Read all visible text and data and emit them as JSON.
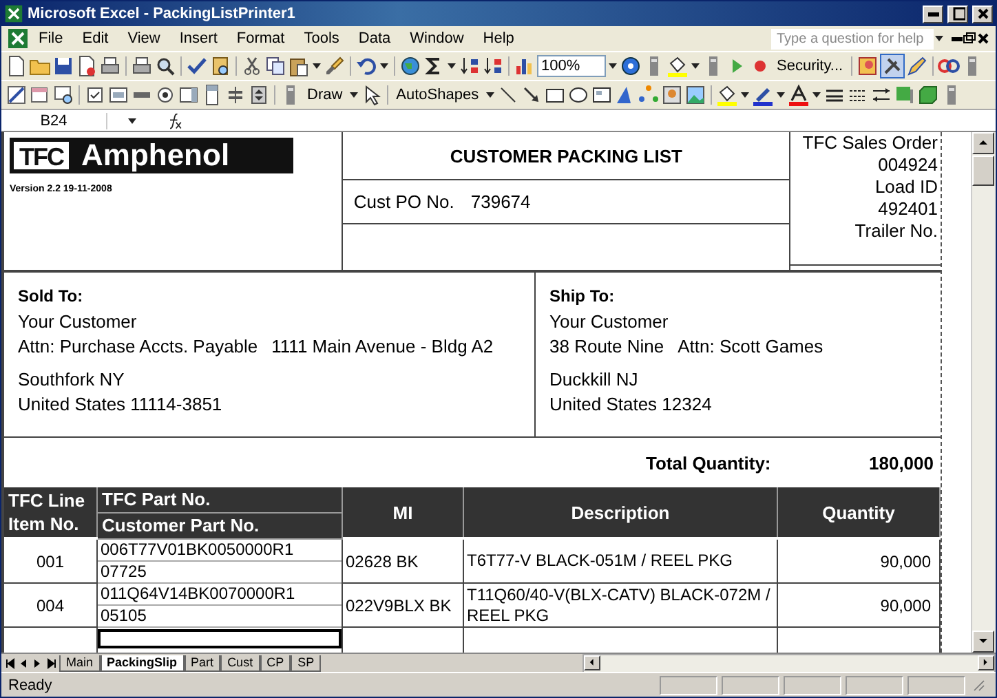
{
  "window": {
    "title": "Microsoft Excel - PackingListPrinter1"
  },
  "menu": {
    "items": [
      "File",
      "Edit",
      "View",
      "Insert",
      "Format",
      "Tools",
      "Data",
      "Window",
      "Help"
    ],
    "help_box": {
      "placeholder": "Type a question for help"
    }
  },
  "standard_toolbar": {
    "zoom": "100%",
    "security": "Security..."
  },
  "drawing_toolbar": {
    "draw": "Draw",
    "autoshapes": "AutoShapes"
  },
  "formula_bar": {
    "name_box": "B24"
  },
  "sheet": {
    "header": {
      "logo_mark": "TFC",
      "logo_text": "Amphenol",
      "version": "Version 2.2 19-11-2008",
      "title": "CUSTOMER PACKING LIST",
      "cust_po_label": "Cust PO No.",
      "cust_po": "739674",
      "sales_order_label": "TFC Sales Order",
      "sales_order": "004924",
      "load_id_label": "Load ID",
      "load_id": "492401",
      "trailer_label": "Trailer No."
    },
    "sold_to": {
      "heading": "Sold To:",
      "name": "Your Customer",
      "line_a": "Attn: Purchase Accts. Payable",
      "line_b": "1111 Main Avenue - Bldg A2",
      "city": "Southfork  NY",
      "country": "United States  11114-3851"
    },
    "ship_to": {
      "heading": "Ship To:",
      "name": "Your Customer",
      "line_a": "38 Route Nine",
      "line_b": "Attn: Scott Games",
      "city": "Duckkill  NJ",
      "country": "United States  12324"
    },
    "total": {
      "label": "Total Quantity:",
      "value": "180,000"
    },
    "table": {
      "columns": [
        "TFC Line Item No.",
        "TFC Part No.",
        "Customer Part No.",
        "MI",
        "Description",
        "Quantity"
      ],
      "rows": [
        {
          "line": "001",
          "tfc_part": "006T77V01BK0050000R1",
          "customer_part": "07725",
          "mi": "02628 BK",
          "description": "T6T77-V BLACK-051M / REEL PKG",
          "quantity": "90,000"
        },
        {
          "line": "004",
          "tfc_part": "011Q64V14BK0070000R1",
          "customer_part": "05105",
          "mi": "022V9BLX BK",
          "description": "T11Q60/40-V(BLX-CATV) BLACK-072M / REEL PKG",
          "quantity": "90,000"
        }
      ]
    }
  },
  "sheet_tabs": [
    {
      "label": "Main",
      "selected": false
    },
    {
      "label": "PackingSlip",
      "selected": true
    },
    {
      "label": "Part",
      "selected": false
    },
    {
      "label": "Cust",
      "selected": false
    },
    {
      "label": "CP",
      "selected": false
    },
    {
      "label": "SP",
      "selected": false
    }
  ],
  "status_bar": {
    "text": "Ready"
  }
}
